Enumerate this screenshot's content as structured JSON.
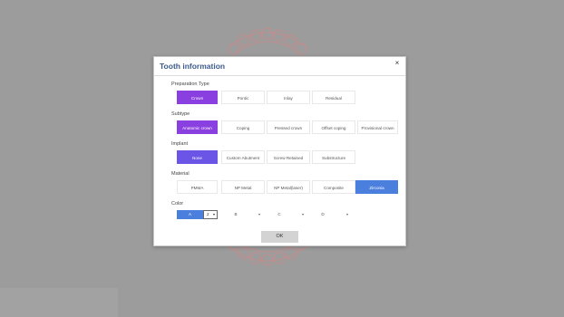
{
  "dialog": {
    "title": "Tooth information",
    "close_symbol": "×",
    "close_icon": "close-icon"
  },
  "sections": {
    "preparation": {
      "label": "Preparation Type",
      "options": [
        "Crown",
        "Pontic",
        "Inlay",
        "Residual"
      ],
      "selected": "Crown"
    },
    "subtype": {
      "label": "Subtype",
      "options": [
        "Anatomic crown",
        "Coping",
        "Pressed crown",
        "Offset coping",
        "Provisional crown"
      ],
      "selected": "Anatomic crown"
    },
    "implant": {
      "label": "Implant",
      "options": [
        "None",
        "Custom Abutment",
        "Screw Retained",
        "Substructure"
      ],
      "selected": "None"
    },
    "material": {
      "label": "Material",
      "options": [
        "PMMA",
        "NP Metal",
        "NP Metal(laser)",
        "Composite",
        "Zirconia"
      ],
      "selected": "Zirconia"
    },
    "color": {
      "label": "Color",
      "shades": [
        "A",
        "B",
        "C",
        "D"
      ],
      "selected_shade": "A",
      "selected_number": "2",
      "caret": "▾"
    }
  },
  "ok_label": "OK",
  "colors": {
    "purple": "#8a3fe0",
    "indigo": "#6a55e6",
    "blue": "#4a7fde",
    "title": "#3b5a8c"
  }
}
